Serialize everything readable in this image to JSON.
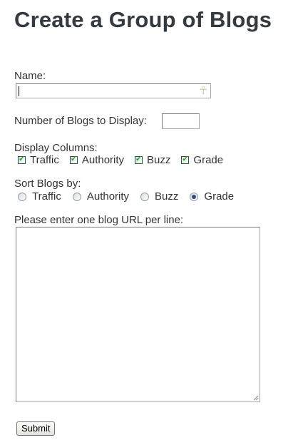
{
  "page_title": "Create a Group of Blogs",
  "name_field": {
    "label": "Name:",
    "value": ""
  },
  "number_field": {
    "label": "Number of Blogs to Display:",
    "value": ""
  },
  "display_columns": {
    "label": "Display Columns:",
    "options": [
      {
        "label": "Traffic",
        "checked": true
      },
      {
        "label": "Authority",
        "checked": true
      },
      {
        "label": "Buzz",
        "checked": true
      },
      {
        "label": "Grade",
        "checked": true
      }
    ]
  },
  "sort_by": {
    "label": "Sort Blogs by:",
    "selected": "Grade",
    "options": [
      {
        "label": "Traffic"
      },
      {
        "label": "Authority"
      },
      {
        "label": "Buzz"
      },
      {
        "label": "Grade"
      }
    ]
  },
  "urls_field": {
    "label": "Please enter one blog URL per line:",
    "value": ""
  },
  "submit_button": {
    "label": "Submit"
  },
  "icons": {
    "autofill_icon": "ankh-icon",
    "tick_glyph": "✓"
  },
  "colors": {
    "title": "#333a40",
    "text": "#333333",
    "checkbox_border": "#1c5180",
    "checkmark": "#21a121",
    "radio_dot": "#2c4f7c"
  }
}
